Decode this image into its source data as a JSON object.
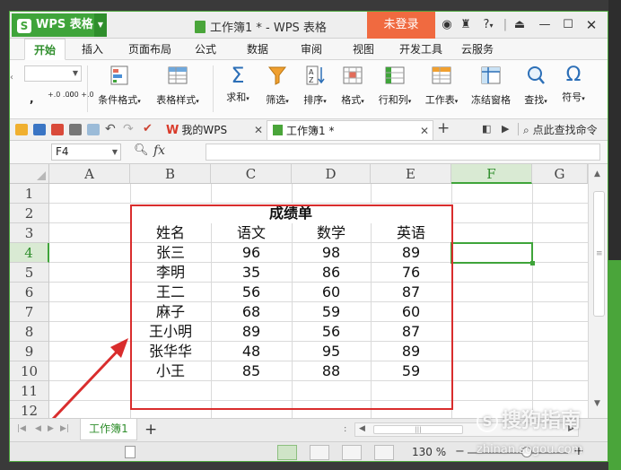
{
  "app": {
    "menu_button": "WPS 表格",
    "menu_logo": "S",
    "document_title": "工作簿1 * - WPS 表格",
    "login_button": "未登录",
    "help_symbol": "?"
  },
  "menu_tabs": [
    "开始",
    "插入",
    "页面布局",
    "公式",
    "数据",
    "审阅",
    "视图",
    "开发工具",
    "云服务"
  ],
  "ribbon": {
    "buttons": [
      "条件格式",
      "表格样式",
      "求和",
      "筛选",
      "排序",
      "格式",
      "行和列",
      "工作表",
      "冻结窗格",
      "查找",
      "符号"
    ],
    "small_labels": {
      "dec_inc": "+.0 .00",
      "dec_dec": ".00 +.0"
    }
  },
  "doc_tabs": {
    "wps_tab": "我的WPS",
    "workbook_tab": "工作簿1 *",
    "add": "+",
    "search_cmd": "点此查找命令"
  },
  "formula_bar": {
    "name_box": "F4",
    "fx": "fx",
    "formula": ""
  },
  "grid": {
    "columns": [
      "A",
      "B",
      "C",
      "D",
      "E",
      "F",
      "G"
    ],
    "rows": [
      "1",
      "2",
      "3",
      "4",
      "5",
      "6",
      "7",
      "8",
      "9",
      "10",
      "11",
      "12"
    ],
    "selected_column": "F",
    "selected_row": "4",
    "table_title": "成绩单",
    "headers": [
      "姓名",
      "语文",
      "数学",
      "英语"
    ],
    "records": [
      [
        "张三",
        "96",
        "98",
        "89"
      ],
      [
        "李明",
        "35",
        "86",
        "76"
      ],
      [
        "王二",
        "56",
        "60",
        "87"
      ],
      [
        "麻子",
        "68",
        "59",
        "60"
      ],
      [
        "王小明",
        "89",
        "56",
        "87"
      ],
      [
        "张华华",
        "48",
        "95",
        "89"
      ],
      [
        "小王",
        "85",
        "88",
        "59"
      ]
    ]
  },
  "sheets": {
    "tabs": [
      "工作簿1"
    ],
    "add": "+"
  },
  "status": {
    "zoom": "130 %",
    "zoom_level_percent": 130
  },
  "watermark": {
    "text": "搜狗指南",
    "url": "zhinan.sogou.com"
  },
  "colors": {
    "accent_green": "#3fa43a",
    "login_orange": "#f06a40",
    "annotation_red": "#d92d2d"
  }
}
